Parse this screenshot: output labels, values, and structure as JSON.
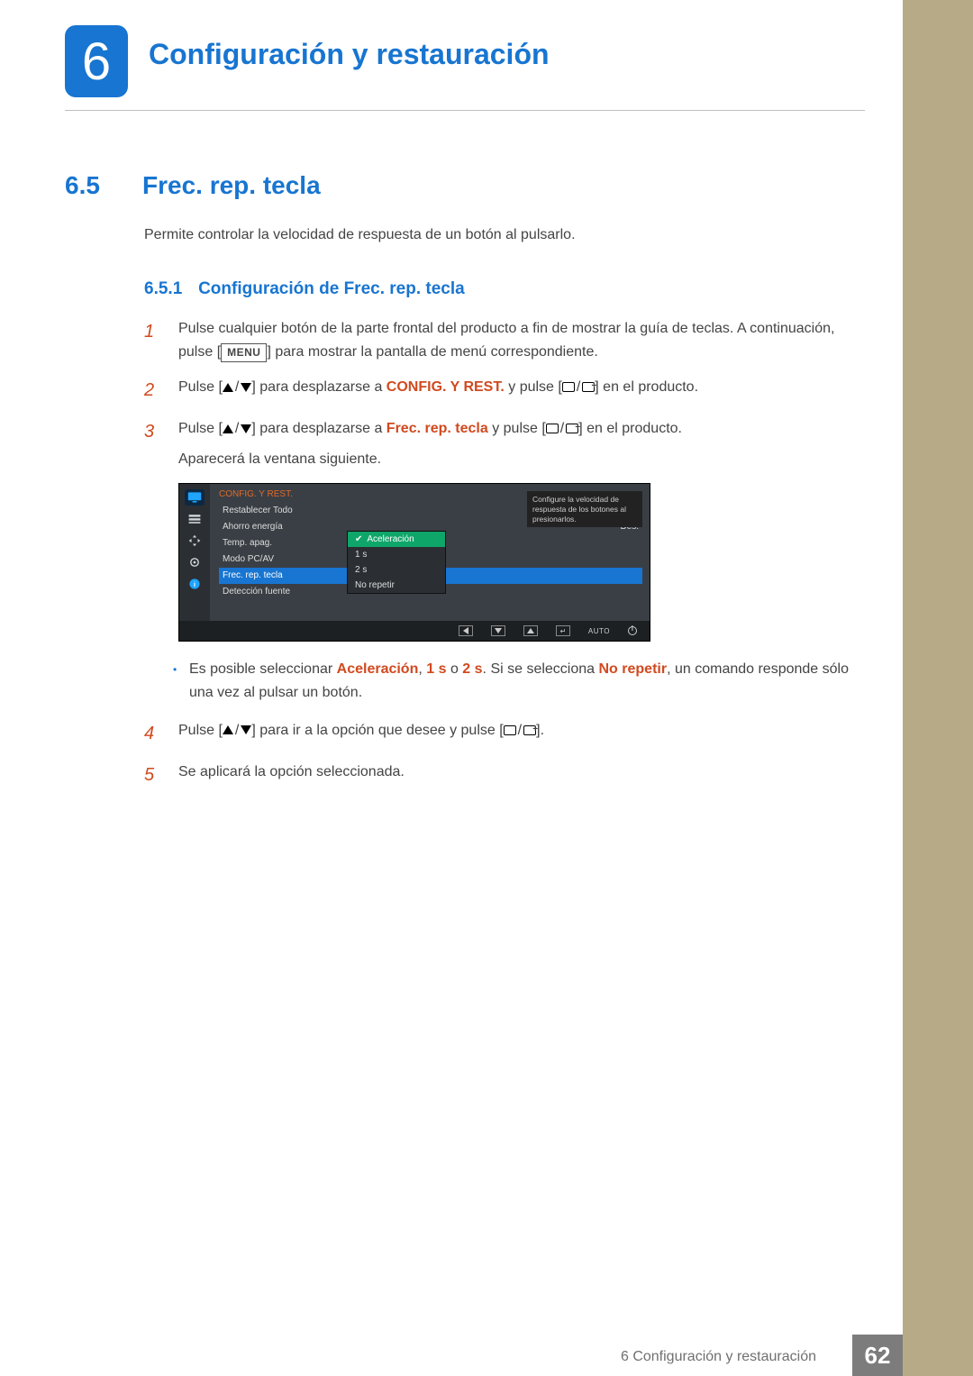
{
  "chapter": {
    "number": "6",
    "title": "Configuración y restauración"
  },
  "section": {
    "number": "6.5",
    "title": "Frec. rep. tecla"
  },
  "intro": "Permite controlar la velocidad de respuesta de un botón al pulsarlo.",
  "subsection": {
    "number": "6.5.1",
    "title": "Configuración de Frec. rep. tecla"
  },
  "steps": {
    "s1": {
      "a": "Pulse cualquier botón de la parte frontal del producto a fin de mostrar la guía de teclas. A continuación, pulse [",
      "menu": "MENU",
      "b": "] para mostrar la pantalla de menú correspondiente."
    },
    "s2": {
      "a": "Pulse [",
      "b": "] para desplazarse a ",
      "strong": "CONFIG. Y REST.",
      "c": " y pulse [",
      "d": "] en el producto."
    },
    "s3": {
      "a": "Pulse [",
      "b": "] para desplazarse a ",
      "strong": "Frec. rep. tecla",
      "c": " y pulse [",
      "d": "] en el producto.",
      "tail": "Aparecerá la ventana siguiente."
    },
    "s4": {
      "a": "Pulse [",
      "b": "] para ir a la opción que desee y pulse [",
      "c": "]."
    },
    "s5": "Se aplicará la opción seleccionada."
  },
  "osd": {
    "title": "CONFIG. Y REST.",
    "items": {
      "i0": "Restablecer Todo",
      "i1": "Ahorro energía",
      "i1v": "Des.",
      "i2": "Temp. apag.",
      "i3": "Modo PC/AV",
      "i4": "Frec. rep. tecla",
      "i5": "Detección fuente"
    },
    "popup": {
      "p0": "Aceleración",
      "p1": "1 s",
      "p2": "2 s",
      "p3": "No repetir"
    },
    "tooltip": "Configure la velocidad de respuesta de los botones al presionarlos.",
    "bottom": {
      "auto": "AUTO"
    }
  },
  "note": {
    "a": "Es posible seleccionar ",
    "b": "Aceleración",
    "c": ", ",
    "d": "1 s",
    "e": " o ",
    "f": "2 s",
    "g": ". Si se selecciona ",
    "h": "No repetir",
    "i": ", un comando responde sólo una vez al pulsar un botón."
  },
  "footer": {
    "text": "6 Configuración y restauración",
    "page": "62"
  }
}
